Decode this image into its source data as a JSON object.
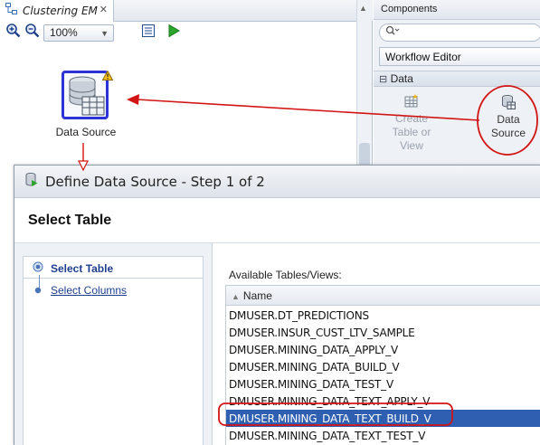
{
  "editor": {
    "tab_title": "Clustering EM",
    "zoom": "100%",
    "node_label": "Data Source"
  },
  "palette": {
    "header": "Components",
    "selector": "Workflow Editor",
    "section": "Data",
    "items": [
      {
        "label_l1": "Create",
        "label_l2": "Table or",
        "label_l3": "View"
      },
      {
        "label_l1": "Data",
        "label_l2": "Source"
      }
    ]
  },
  "dialog": {
    "title": "Define Data Source - Step 1 of 2",
    "heading": "Select Table",
    "steps": [
      "Select Table",
      "Select Columns"
    ],
    "available_label": "Available Tables/Views:",
    "column_header": "Name",
    "rows": [
      "DMUSER.DT_PREDICTIONS",
      "DMUSER.INSUR_CUST_LTV_SAMPLE",
      "DMUSER.MINING_DATA_APPLY_V",
      "DMUSER.MINING_DATA_BUILD_V",
      "DMUSER.MINING_DATA_TEST_V",
      "DMUSER.MINING_DATA_TEXT_APPLY_V",
      "DMUSER.MINING_DATA_TEXT_BUILD_V",
      "DMUSER.MINING_DATA_TEXT_TEST_V"
    ],
    "selected_row": "DMUSER.MINING_DATA_TEXT_BUILD_V"
  },
  "colors": {
    "annotation": "#d21414",
    "selection": "#2e5fb1",
    "node_border": "#2c34d8"
  }
}
